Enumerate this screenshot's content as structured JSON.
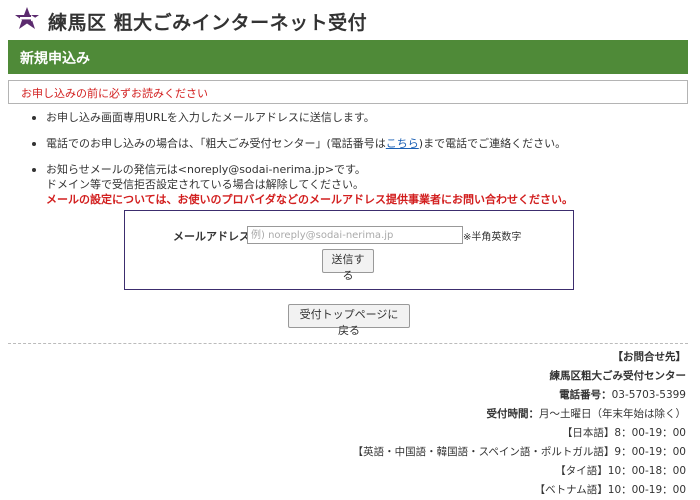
{
  "header": {
    "title": "練馬区 粗大ごみインターネット受付",
    "logo_icon": "nerima-ward-logo"
  },
  "banner": {
    "title": "新規申込み"
  },
  "notice": {
    "text": "お申し込みの前に必ずお読みください"
  },
  "info": {
    "item1": "お申し込み画面専用URLを入力したメールアドレスに送信します。",
    "item2_a": "電話でのお申し込みの場合は、「粗大ごみ受付センター」(電話番号は",
    "item2_link": "こちら",
    "item2_b": ")まで電話でご連絡ください。",
    "item3_line1": "お知らせメールの発信元は<noreply@sodai-nerima.jp>です。",
    "item3_line2": "ドメイン等で受信拒否設定されている場合は解除してください。",
    "item3_line3": "メールの設定については、お使いのプロバイダなどのメールアドレス提供事業者にお問い合わせください。"
  },
  "form": {
    "email_label": "メールアドレス",
    "email_placeholder": "例) noreply@sodai-nerima.jp",
    "email_note": "※半角英数字",
    "submit_label": "送信する"
  },
  "back_button": "受付トップページに戻る",
  "contact": {
    "heading": "【お問合せ先】",
    "org": "練馬区粗大ごみ受付センター",
    "phone_label": "電話番号：",
    "phone": "03-5703-5399",
    "hours_label": "受付時間：",
    "hours": "月～土曜日（年末年始は除く）",
    "japanese": "【日本語】8：00-19：00",
    "multi": "【英語・中国語・韓国語・スペイン語・ポルトガル語】9：00-19：00",
    "thai": "【タイ語】10：00-18：00",
    "vietnamese": "【ベトナム語】10：00-19：00"
  },
  "colors": {
    "banner": "#4f8a38",
    "alert_red": "#d21e1e",
    "form_border": "#3c2d6e",
    "logo": "#5b2a6e"
  }
}
